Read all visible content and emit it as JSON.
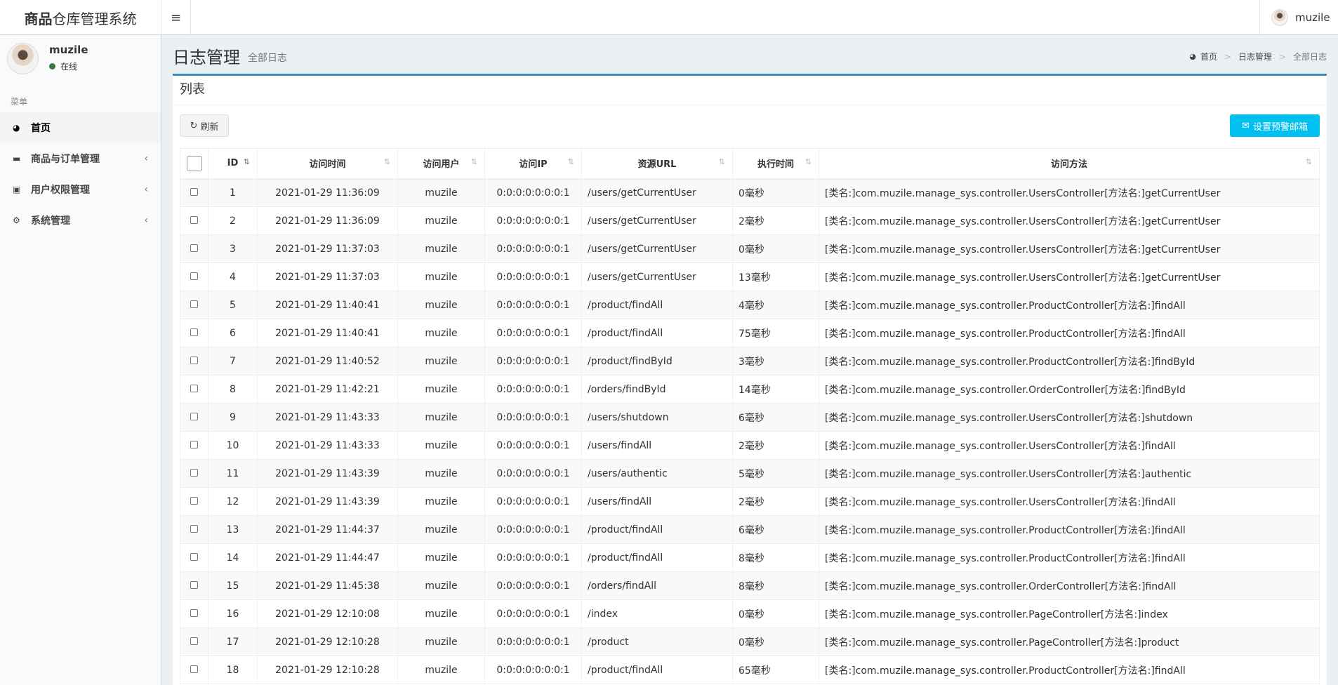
{
  "app": {
    "logo_bold": "商品",
    "logo_light": "仓库管理系统",
    "menu_toggle_icon": "≡",
    "top_user": "muzile"
  },
  "sidebar": {
    "user_name": "muzile",
    "status": "在线",
    "menu_header": "菜单",
    "items": [
      {
        "label": "首页",
        "icon": "dashboard-icon"
      },
      {
        "label": "商品与订单管理",
        "icon": "folder-icon"
      },
      {
        "label": "用户权限管理",
        "icon": "lock-icon"
      },
      {
        "label": "系统管理",
        "icon": "cogs-icon"
      }
    ]
  },
  "header": {
    "title": "日志管理",
    "subtitle": "全部日志",
    "breadcrumb": [
      "首页",
      "日志管理",
      "全部日志"
    ]
  },
  "box": {
    "title": "列表",
    "refresh_label": "刷新",
    "email_label": "设置预警邮箱"
  },
  "table": {
    "columns": [
      "ID",
      "访问时间",
      "访问用户",
      "访问IP",
      "资源URL",
      "执行时间",
      "访问方法"
    ],
    "rows": [
      [
        "1",
        "2021-01-29 11:36:09",
        "muzile",
        "0:0:0:0:0:0:0:1",
        "/users/getCurrentUser",
        "0毫秒",
        "[类名:]com.muzile.manage_sys.controller.UsersController[方法名:]getCurrentUser"
      ],
      [
        "2",
        "2021-01-29 11:36:09",
        "muzile",
        "0:0:0:0:0:0:0:1",
        "/users/getCurrentUser",
        "2毫秒",
        "[类名:]com.muzile.manage_sys.controller.UsersController[方法名:]getCurrentUser"
      ],
      [
        "3",
        "2021-01-29 11:37:03",
        "muzile",
        "0:0:0:0:0:0:0:1",
        "/users/getCurrentUser",
        "0毫秒",
        "[类名:]com.muzile.manage_sys.controller.UsersController[方法名:]getCurrentUser"
      ],
      [
        "4",
        "2021-01-29 11:37:03",
        "muzile",
        "0:0:0:0:0:0:0:1",
        "/users/getCurrentUser",
        "13毫秒",
        "[类名:]com.muzile.manage_sys.controller.UsersController[方法名:]getCurrentUser"
      ],
      [
        "5",
        "2021-01-29 11:40:41",
        "muzile",
        "0:0:0:0:0:0:0:1",
        "/product/findAll",
        "4毫秒",
        "[类名:]com.muzile.manage_sys.controller.ProductController[方法名:]findAll"
      ],
      [
        "6",
        "2021-01-29 11:40:41",
        "muzile",
        "0:0:0:0:0:0:0:1",
        "/product/findAll",
        "75毫秒",
        "[类名:]com.muzile.manage_sys.controller.ProductController[方法名:]findAll"
      ],
      [
        "7",
        "2021-01-29 11:40:52",
        "muzile",
        "0:0:0:0:0:0:0:1",
        "/product/findById",
        "3毫秒",
        "[类名:]com.muzile.manage_sys.controller.ProductController[方法名:]findById"
      ],
      [
        "8",
        "2021-01-29 11:42:21",
        "muzile",
        "0:0:0:0:0:0:0:1",
        "/orders/findById",
        "14毫秒",
        "[类名:]com.muzile.manage_sys.controller.OrderController[方法名:]findById"
      ],
      [
        "9",
        "2021-01-29 11:43:33",
        "muzile",
        "0:0:0:0:0:0:0:1",
        "/users/shutdown",
        "6毫秒",
        "[类名:]com.muzile.manage_sys.controller.UsersController[方法名:]shutdown"
      ],
      [
        "10",
        "2021-01-29 11:43:33",
        "muzile",
        "0:0:0:0:0:0:0:1",
        "/users/findAll",
        "2毫秒",
        "[类名:]com.muzile.manage_sys.controller.UsersController[方法名:]findAll"
      ],
      [
        "11",
        "2021-01-29 11:43:39",
        "muzile",
        "0:0:0:0:0:0:0:1",
        "/users/authentic",
        "5毫秒",
        "[类名:]com.muzile.manage_sys.controller.UsersController[方法名:]authentic"
      ],
      [
        "12",
        "2021-01-29 11:43:39",
        "muzile",
        "0:0:0:0:0:0:0:1",
        "/users/findAll",
        "2毫秒",
        "[类名:]com.muzile.manage_sys.controller.UsersController[方法名:]findAll"
      ],
      [
        "13",
        "2021-01-29 11:44:37",
        "muzile",
        "0:0:0:0:0:0:0:1",
        "/product/findAll",
        "6毫秒",
        "[类名:]com.muzile.manage_sys.controller.ProductController[方法名:]findAll"
      ],
      [
        "14",
        "2021-01-29 11:44:47",
        "muzile",
        "0:0:0:0:0:0:0:1",
        "/product/findAll",
        "8毫秒",
        "[类名:]com.muzile.manage_sys.controller.ProductController[方法名:]findAll"
      ],
      [
        "15",
        "2021-01-29 11:45:38",
        "muzile",
        "0:0:0:0:0:0:0:1",
        "/orders/findAll",
        "8毫秒",
        "[类名:]com.muzile.manage_sys.controller.OrderController[方法名:]findAll"
      ],
      [
        "16",
        "2021-01-29 12:10:08",
        "muzile",
        "0:0:0:0:0:0:0:1",
        "/index",
        "0毫秒",
        "[类名:]com.muzile.manage_sys.controller.PageController[方法名:]index"
      ],
      [
        "17",
        "2021-01-29 12:10:28",
        "muzile",
        "0:0:0:0:0:0:0:1",
        "/product",
        "0毫秒",
        "[类名:]com.muzile.manage_sys.controller.PageController[方法名:]product"
      ],
      [
        "18",
        "2021-01-29 12:10:28",
        "muzile",
        "0:0:0:0:0:0:0:1",
        "/product/findAll",
        "65毫秒",
        "[类名:]com.muzile.manage_sys.controller.ProductController[方法名:]findAll"
      ]
    ]
  }
}
